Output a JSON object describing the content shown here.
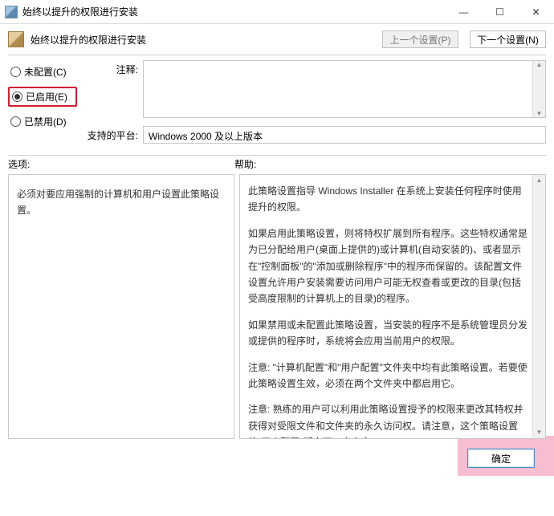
{
  "window": {
    "title": "始终以提升的权限进行安装"
  },
  "subheader": {
    "title": "始终以提升的权限进行安装"
  },
  "nav": {
    "prev": "上一个设置(P)",
    "next": "下一个设置(N)"
  },
  "radios": {
    "not_configured": "未配置(C)",
    "enabled": "已启用(E)",
    "disabled": "已禁用(D)",
    "selected": "enabled"
  },
  "fields": {
    "comment_label": "注释:",
    "comment_value": "",
    "platform_label": "支持的平台:",
    "platform_value": "Windows 2000 及以上版本"
  },
  "sections": {
    "options_label": "选项:",
    "help_label": "帮助:"
  },
  "options": {
    "text": "必须对要应用强制的计算机和用户设置此策略设置。"
  },
  "help": {
    "p1": "此策略设置指导 Windows Installer 在系统上安装任何程序时使用提升的权限。",
    "p2": "如果启用此策略设置，则将特权扩展到所有程序。这些特权通常是为已分配给用户(桌面上提供的)或计算机(自动安装的)、或者显示在\"控制面板\"的\"添加或删除程序\"中的程序而保留的。该配置文件设置允许用户安装需要访问用户可能无权查看或更改的目录(包括受高度限制的计算机上的目录)的程序。",
    "p3": "如果禁用或未配置此策略设置，当安装的程序不是系统管理员分发或提供的程序时，系统将会应用当前用户的权限。",
    "p4": "注意: \"计算机配置\"和\"用户配置\"文件夹中均有此策略设置。若要使此策略设置生效，必须在两个文件夹中都启用它。",
    "p5": "注意: 熟练的用户可以利用此策略设置授予的权限来更改其特权并获得对受限文件和文件夹的永久访问权。请注意，这个策略设置的\"用户配置\"版本不一定安全。"
  },
  "footer": {
    "ok": "确定"
  }
}
